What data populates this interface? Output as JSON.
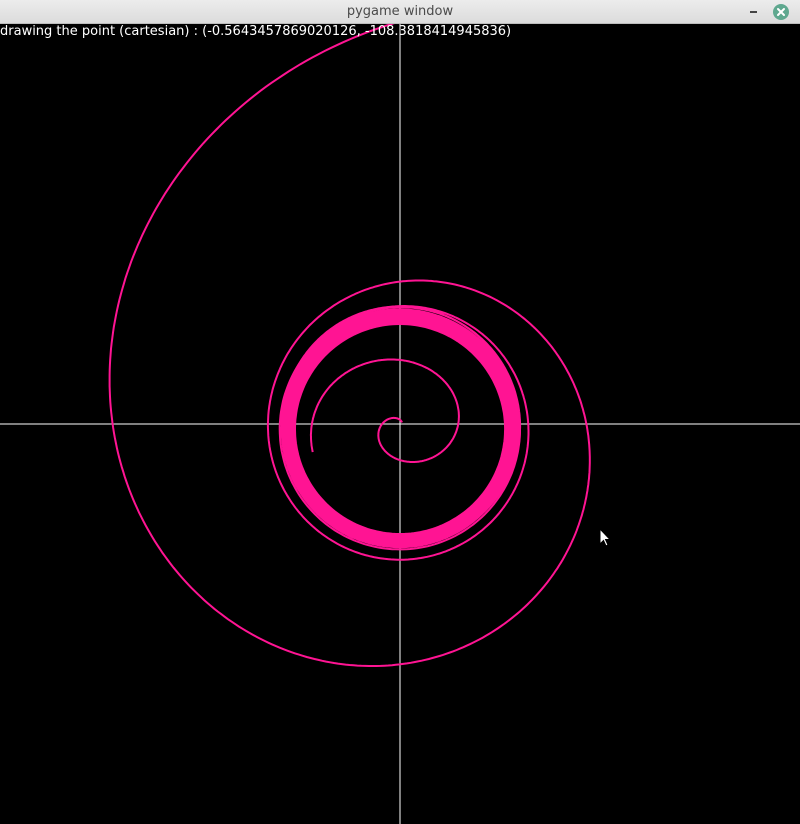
{
  "window": {
    "title": "pygame window"
  },
  "status": {
    "label": "drawing the point (cartesian) : ",
    "point_text": "(-0.5643457869020126, -108.3818414945836)"
  },
  "colors": {
    "background": "#000000",
    "axes": "#ffffff",
    "spiral": "#ff1493",
    "close_button": "#5fa88f"
  },
  "icons": {
    "minimize": "minimize-icon",
    "close": "close-icon",
    "cursor": "mouse-cursor-icon"
  }
}
